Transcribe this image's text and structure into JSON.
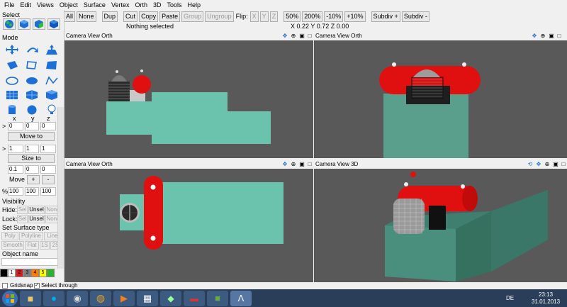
{
  "menu": [
    "File",
    "Edit",
    "Views",
    "Object",
    "Surface",
    "Vertex",
    "Orth",
    "3D",
    "Tools",
    "Help"
  ],
  "toolbar": {
    "all": "All",
    "none": "None",
    "dup": "Dup",
    "cut": "Cut",
    "copy": "Copy",
    "paste": "Paste",
    "group": "Group",
    "ungroup": "Ungroup",
    "flip_label": "Flip:",
    "flip_x": "X",
    "flip_y": "Y",
    "flip_z": "Z",
    "zoom50": "50%",
    "zoom200": "200%",
    "minus10": "-10%",
    "plus10": "+10%",
    "subdiv_plus": "Subdiv +",
    "subdiv_minus": "Subdiv -"
  },
  "status": {
    "selection": "Nothing selected",
    "coords": "X 0.22 Y 0.72 Z 0.00"
  },
  "left": {
    "select_title": "Select",
    "mode_title": "Mode",
    "axes": [
      "x",
      "y",
      "z"
    ],
    "move_vals": [
      "0",
      "0",
      "0"
    ],
    "move_to": "Move to",
    "size_vals": [
      "1",
      "1",
      "1"
    ],
    "size_to": "Size to",
    "step_vals": [
      "0.1",
      "0",
      "0"
    ],
    "move": "Move",
    "plus": "+",
    "minus": "-",
    "pct_label": "%",
    "pct_vals": [
      "100",
      "100",
      "100"
    ],
    "arrow": ">",
    "visibility_title": "Visibility",
    "hide_label": "Hide:",
    "lock_label": "Lock:",
    "sel": "Sel",
    "unsel": "Unsel",
    "none": "None",
    "surface_title": "Set Surface type",
    "poly": "Poly",
    "polyline": "Polyline",
    "line": "Line",
    "smooth": "Smooth",
    "flat": "Flat",
    "s1": "1S",
    "s2": "2S",
    "object_name": "Object name",
    "palette": [
      "",
      "1",
      "2",
      "3",
      "4",
      "5",
      ""
    ]
  },
  "palette_colors": [
    "#000000",
    "#ffffff",
    "#d22020",
    "#808080",
    "#ff8000",
    "#ffff00",
    "#30b030"
  ],
  "viewports": {
    "tl": {
      "title": "Camera View Orth"
    },
    "tr": {
      "title": "Camera View Orth"
    },
    "bl": {
      "title": "Camera View Orth"
    },
    "br": {
      "title": "Camera View 3D"
    }
  },
  "bottom": {
    "gridsnap": "Gridsnap",
    "select_through": "Select through"
  },
  "taskbar": {
    "lang": "DE",
    "time": "23:13",
    "date": "31.01.2013"
  },
  "colors": {
    "viewport_bg": "#595959",
    "teal": "#6bc2ad",
    "red": "#e01010"
  }
}
